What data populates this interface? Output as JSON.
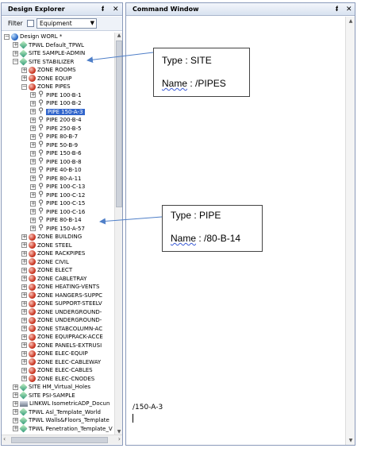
{
  "explorer": {
    "title": "Design Explorer",
    "pin": "ᵮ",
    "close": "✕",
    "filter_label": "Filter",
    "filter_value": "Equipment",
    "tree": [
      {
        "label": "Design WORL *",
        "type": "world",
        "indent": 0,
        "exp": "−"
      },
      {
        "label": "TPWL Default_TPWL",
        "type": "site",
        "indent": 1,
        "exp": "+"
      },
      {
        "label": "SITE SAMPLE-ADMIN",
        "type": "site",
        "indent": 1,
        "exp": "+"
      },
      {
        "label": "SITE STABILIZER",
        "type": "site",
        "indent": 1,
        "exp": "−"
      },
      {
        "label": "ZONE ROOMS",
        "type": "zone",
        "indent": 2,
        "exp": "+"
      },
      {
        "label": "ZONE EQUIP",
        "type": "zone",
        "indent": 2,
        "exp": "+"
      },
      {
        "label": "ZONE PIPES",
        "type": "zone",
        "indent": 2,
        "exp": "−"
      },
      {
        "label": "PIPE 100-B-1",
        "type": "pipe",
        "indent": 3,
        "exp": "+"
      },
      {
        "label": "PIPE 100-B-2",
        "type": "pipe",
        "indent": 3,
        "exp": "+"
      },
      {
        "label": "PIPE 150-A-3",
        "type": "pipe",
        "indent": 3,
        "exp": "+",
        "selected": true
      },
      {
        "label": "PIPE 200-B-4",
        "type": "pipe",
        "indent": 3,
        "exp": "+"
      },
      {
        "label": "PIPE 250-B-5",
        "type": "pipe",
        "indent": 3,
        "exp": "+"
      },
      {
        "label": "PIPE 80-B-7",
        "type": "pipe",
        "indent": 3,
        "exp": "+"
      },
      {
        "label": "PIPE 50-B-9",
        "type": "pipe",
        "indent": 3,
        "exp": "+"
      },
      {
        "label": "PIPE 150-B-6",
        "type": "pipe",
        "indent": 3,
        "exp": "+"
      },
      {
        "label": "PIPE 100-B-8",
        "type": "pipe",
        "indent": 3,
        "exp": "+"
      },
      {
        "label": "PIPE 40-B-10",
        "type": "pipe",
        "indent": 3,
        "exp": "+"
      },
      {
        "label": "PIPE 80-A-11",
        "type": "pipe",
        "indent": 3,
        "exp": "+"
      },
      {
        "label": "PIPE 100-C-13",
        "type": "pipe",
        "indent": 3,
        "exp": "+"
      },
      {
        "label": "PIPE 100-C-12",
        "type": "pipe",
        "indent": 3,
        "exp": "+"
      },
      {
        "label": "PIPE 100-C-15",
        "type": "pipe",
        "indent": 3,
        "exp": "+"
      },
      {
        "label": "PIPE 100-C-16",
        "type": "pipe",
        "indent": 3,
        "exp": "+"
      },
      {
        "label": "PIPE 80-B-14",
        "type": "pipe",
        "indent": 3,
        "exp": "+"
      },
      {
        "label": "PIPE 150-A-57",
        "type": "pipe",
        "indent": 3,
        "exp": "+"
      },
      {
        "label": "ZONE BUILDING",
        "type": "zone",
        "indent": 2,
        "exp": "+"
      },
      {
        "label": "ZONE STEEL",
        "type": "zone",
        "indent": 2,
        "exp": "+"
      },
      {
        "label": "ZONE RACKPIPES",
        "type": "zone",
        "indent": 2,
        "exp": "+"
      },
      {
        "label": "ZONE CIVIL",
        "type": "zone",
        "indent": 2,
        "exp": "+"
      },
      {
        "label": "ZONE ELECT",
        "type": "zone",
        "indent": 2,
        "exp": "+"
      },
      {
        "label": "ZONE CABLETRAY",
        "type": "zone",
        "indent": 2,
        "exp": "+"
      },
      {
        "label": "ZONE HEATING-VENTS",
        "type": "zone",
        "indent": 2,
        "exp": "+"
      },
      {
        "label": "ZONE HANGERS-SUPPC",
        "type": "zone",
        "indent": 2,
        "exp": "+"
      },
      {
        "label": "ZONE SUPPORT-STEELV",
        "type": "zone",
        "indent": 2,
        "exp": "+"
      },
      {
        "label": "ZONE UNDERGROUND-",
        "type": "zone",
        "indent": 2,
        "exp": "+"
      },
      {
        "label": "ZONE UNDERGROUND-",
        "type": "zone",
        "indent": 2,
        "exp": "+"
      },
      {
        "label": "ZONE STABCOLUMN-AC",
        "type": "zone",
        "indent": 2,
        "exp": "+"
      },
      {
        "label": "ZONE EQUIPRACK-ACCE",
        "type": "zone",
        "indent": 2,
        "exp": "+"
      },
      {
        "label": "ZONE PANELS-EXTRUSI",
        "type": "zone",
        "indent": 2,
        "exp": "+"
      },
      {
        "label": "ZONE ELEC-EQUIP",
        "type": "zone",
        "indent": 2,
        "exp": "+"
      },
      {
        "label": "ZONE ELEC-CABLEWAY",
        "type": "zone",
        "indent": 2,
        "exp": "+"
      },
      {
        "label": "ZONE ELEC-CABLES",
        "type": "zone",
        "indent": 2,
        "exp": "+"
      },
      {
        "label": "ZONE ELEC-CNODES",
        "type": "zone",
        "indent": 2,
        "exp": "+"
      },
      {
        "label": "SITE HM_Virtual_Holes",
        "type": "site",
        "indent": 1,
        "exp": "+"
      },
      {
        "label": "SITE PSI-SAMPLE",
        "type": "site",
        "indent": 1,
        "exp": "+"
      },
      {
        "label": "LINKWL IsometricADP_Docun",
        "type": "link",
        "indent": 1,
        "exp": "+"
      },
      {
        "label": "TPWL Asl_Template_World",
        "type": "site",
        "indent": 1,
        "exp": "+"
      },
      {
        "label": "TPWL Walls&Floors_Template",
        "type": "site",
        "indent": 1,
        "exp": "+"
      },
      {
        "label": "TPWL Penetration_Template_V",
        "type": "site",
        "indent": 1,
        "exp": "+"
      }
    ]
  },
  "command": {
    "title": "Command Window",
    "pin": "ᵮ",
    "close": "✕",
    "text": "/150-A-3"
  },
  "callouts": [
    {
      "type_label": "Type :",
      "type_value": "SITE",
      "name_label": "Name",
      "name_value": ": /PIPES"
    },
    {
      "type_label": "Type :",
      "type_value": "PIPE",
      "name_label": "Name",
      "name_value": ": /80-B-14"
    }
  ],
  "colors": {
    "selection": "#3266cc",
    "zone_icon": "#c8311d",
    "site_icon": "#2f9a7a"
  }
}
